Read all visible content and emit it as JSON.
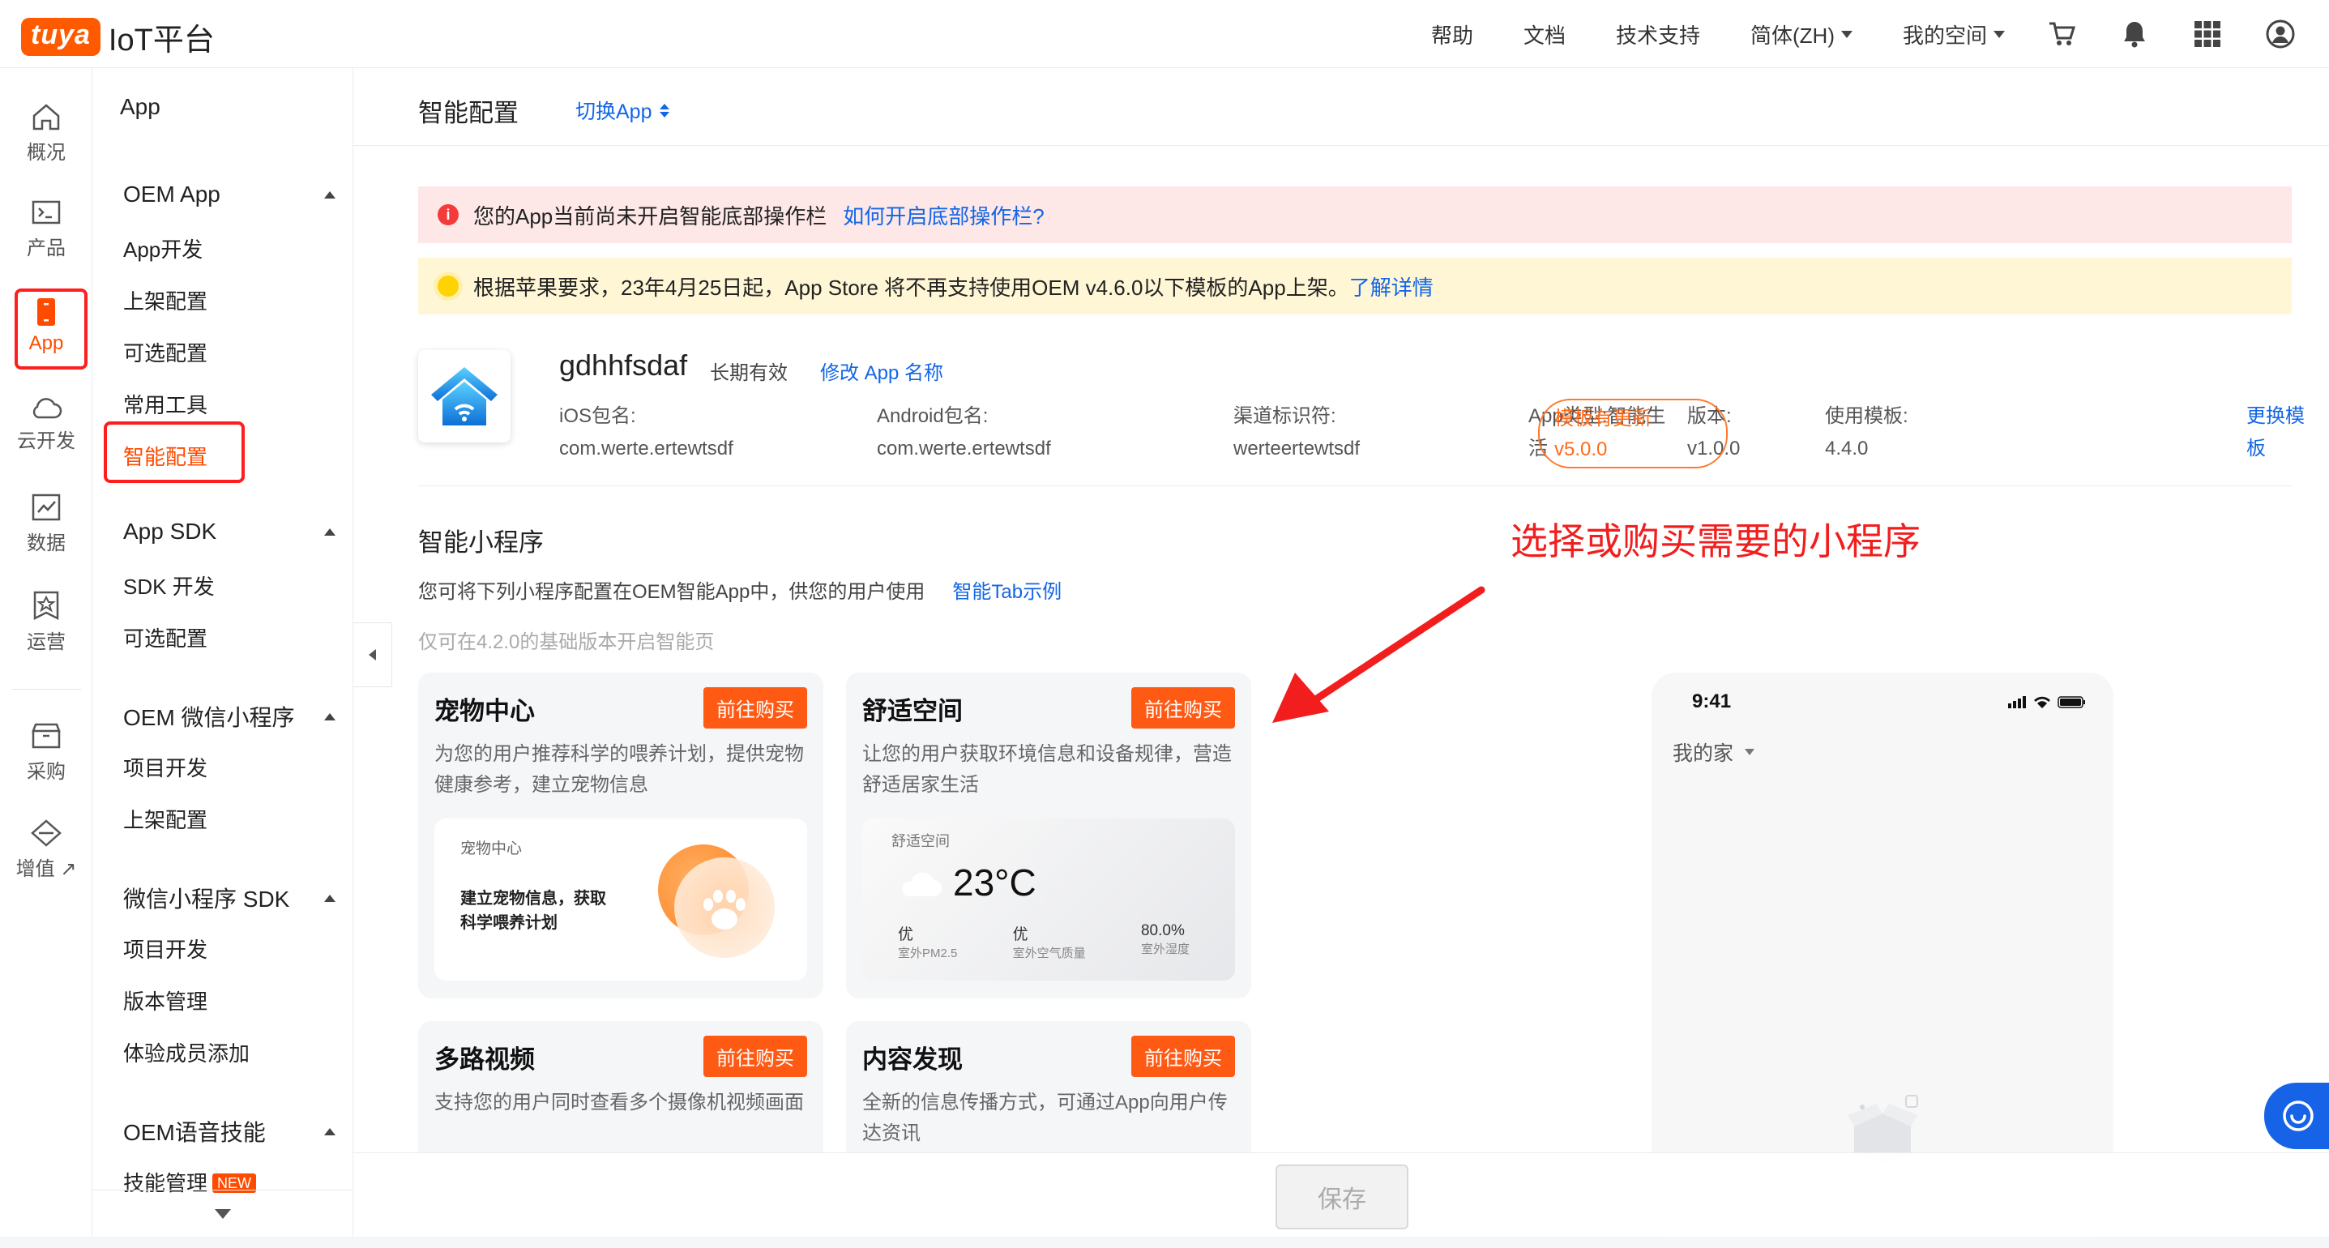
{
  "brand": {
    "badge": "tuya",
    "platform": "IoT平台",
    "accent": "#ff5a00"
  },
  "topnav": {
    "help": "帮助",
    "docs": "文档",
    "support": "技术支持",
    "language": "简体(ZH)",
    "workspace": "我的空间"
  },
  "rail": [
    {
      "label": "概况",
      "icon": "home-icon"
    },
    {
      "label": "产品",
      "icon": "terminal-icon"
    },
    {
      "label": "App",
      "icon": "phone-icon"
    },
    {
      "label": "云开发",
      "icon": "cloud-icon"
    },
    {
      "label": "数据",
      "icon": "chart-icon"
    },
    {
      "label": "运营",
      "icon": "star-badge-icon"
    },
    {
      "label": "采购",
      "icon": "box-icon"
    },
    {
      "label": "增值 ↗",
      "icon": "diamond-icon"
    }
  ],
  "sidebar": {
    "title": "App",
    "groups": [
      {
        "label": "OEM App",
        "items": [
          "App开发",
          "上架配置",
          "可选配置",
          "常用工具",
          "智能配置"
        ]
      },
      {
        "label": "App SDK",
        "items": [
          "SDK 开发",
          "可选配置"
        ]
      },
      {
        "label": "OEM 微信小程序",
        "items": [
          "项目开发",
          "上架配置"
        ]
      },
      {
        "label": "微信小程序 SDK",
        "items": [
          "项目开发",
          "版本管理",
          "体验成员添加"
        ]
      },
      {
        "label": "OEM语音技能",
        "items": [
          "技能管理"
        ]
      }
    ],
    "new_badge": "NEW"
  },
  "page": {
    "title": "智能配置",
    "switch_app": "切换App"
  },
  "alerts": {
    "red": {
      "icon_text": "i",
      "text": "您的App当前尚未开启智能底部操作栏",
      "link": "如何开启底部操作栏?"
    },
    "yellow": {
      "text": "根据苹果要求，23年4月25日起，App Store 将不再支持使用OEM v4.6.0以下模板的App上架。",
      "link": "了解详情"
    }
  },
  "app": {
    "name": "gdhhfsdaf",
    "validity": "长期有效",
    "rename": "修改 App 名称",
    "ios_label": "iOS包名:",
    "ios_value": "com.werte.ertewtsdf",
    "android_label": "Android包名:",
    "android_value": "com.werte.ertewtsdf",
    "channel_label": "渠道标识符:",
    "channel_value": "werteertewtsdf",
    "type_line1": "App类型:智能生",
    "type_line2": "活",
    "version_label": "版本:",
    "version_value": "v1.0.0",
    "template_label": "使用模板:",
    "template_value": "4.4.0",
    "update_line1": "模板有更新",
    "update_line2": "v5.0.0",
    "change_tmpl": "更换模板"
  },
  "miniprograms": {
    "title": "智能小程序",
    "desc": "您可将下列小程序配置在OEM智能App中，供您的用户使用",
    "desc_link": "智能Tab示例",
    "hint": "仅可在4.2.0的基础版本开启智能页",
    "buy_label": "前往购买",
    "cards": [
      {
        "title": "宠物中心",
        "desc": "为您的用户推荐科学的喂养计划，提供宠物健康参考，建立宠物信息"
      },
      {
        "title": "舒适空间",
        "desc": "让您的用户获取环境信息和设备规律，营造舒适居家生活"
      },
      {
        "title": "多路视频",
        "desc": "支持您的用户同时查看多个摄像机视频画面"
      },
      {
        "title": "内容发现",
        "desc": "全新的信息传播方式，可通过App向用户传达资讯"
      }
    ],
    "pet_preview": {
      "label": "宠物中心",
      "text_line1": "建立宠物信息，获取",
      "text_line2": "科学喂养计划"
    },
    "comfort_preview": {
      "label": "舒适空间",
      "temp": "23°C",
      "stats": [
        {
          "value": "优",
          "label": "室外PM2.5"
        },
        {
          "value": "优",
          "label": "室外空气质量"
        },
        {
          "value": "80.0%",
          "label": "室外湿度"
        }
      ]
    }
  },
  "phone": {
    "time": "9:41",
    "home": "我的家"
  },
  "annotation": {
    "text": "选择或购买需要的小程序",
    "color": "#f21e1e"
  },
  "footer": {
    "save": "保存"
  }
}
